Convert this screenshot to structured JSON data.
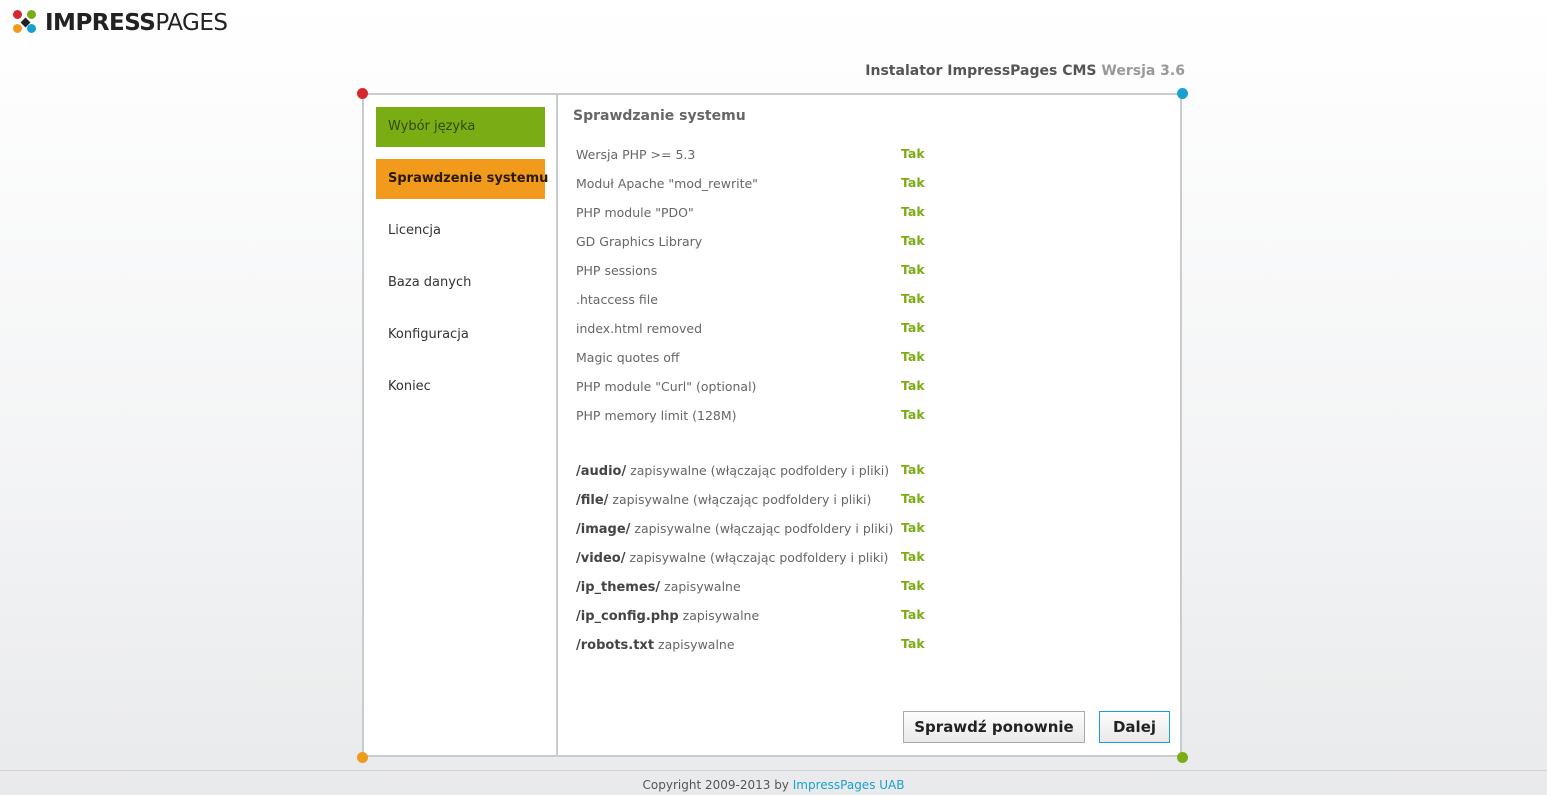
{
  "brand": {
    "name_bold": "IMPRESS",
    "name_light": "PAGES"
  },
  "header": {
    "title": "Instalator ImpressPages CMS",
    "version": "Wersja 3.6"
  },
  "sidebar": {
    "items": [
      {
        "label": "Wybór języka",
        "state": "done"
      },
      {
        "label": "Sprawdzenie systemu",
        "state": "active"
      },
      {
        "label": "Licencja",
        "state": "pending"
      },
      {
        "label": "Baza danych",
        "state": "pending"
      },
      {
        "label": "Konfiguracja",
        "state": "pending"
      },
      {
        "label": "Koniec",
        "state": "pending"
      }
    ]
  },
  "main": {
    "title": "Sprawdzanie systemu",
    "checks": [
      {
        "label": "Wersja PHP >= 5.3",
        "result": "Tak"
      },
      {
        "label": "Moduł Apache \"mod_rewrite\"",
        "result": "Tak"
      },
      {
        "label": "PHP module \"PDO\"",
        "result": "Tak"
      },
      {
        "label": "GD Graphics Library",
        "result": "Tak"
      },
      {
        "label": "PHP sessions",
        "result": "Tak"
      },
      {
        "label": ".htaccess file",
        "result": "Tak"
      },
      {
        "label": "index.html removed",
        "result": "Tak"
      },
      {
        "label": "Magic quotes off",
        "result": "Tak"
      },
      {
        "label": "PHP module \"Curl\" (optional)",
        "result": "Tak"
      },
      {
        "label": "PHP memory limit (128M)",
        "result": "Tak"
      }
    ],
    "writable": [
      {
        "path": "/audio/",
        "desc": "zapisywalne (włączając podfoldery i pliki)",
        "result": "Tak"
      },
      {
        "path": "/file/",
        "desc": "zapisywalne (włączając podfoldery i pliki)",
        "result": "Tak"
      },
      {
        "path": "/image/",
        "desc": "zapisywalne (włączając podfoldery i pliki)",
        "result": "Tak"
      },
      {
        "path": "/video/",
        "desc": "zapisywalne (włączając podfoldery i pliki)",
        "result": "Tak"
      },
      {
        "path": "/ip_themes/",
        "desc": "zapisywalne",
        "result": "Tak"
      },
      {
        "path": "/ip_config.php",
        "desc": "zapisywalne",
        "result": "Tak"
      },
      {
        "path": "/robots.txt",
        "desc": "zapisywalne",
        "result": "Tak"
      }
    ]
  },
  "buttons": {
    "recheck": "Sprawdź ponownie",
    "next": "Dalej"
  },
  "footer": {
    "copyright": "Copyright 2009-2013 by",
    "link": "ImpressPages UAB"
  },
  "colors": {
    "green": "#7aad13",
    "orange": "#f19a1b",
    "red": "#d7262e",
    "blue": "#19a0d0"
  }
}
